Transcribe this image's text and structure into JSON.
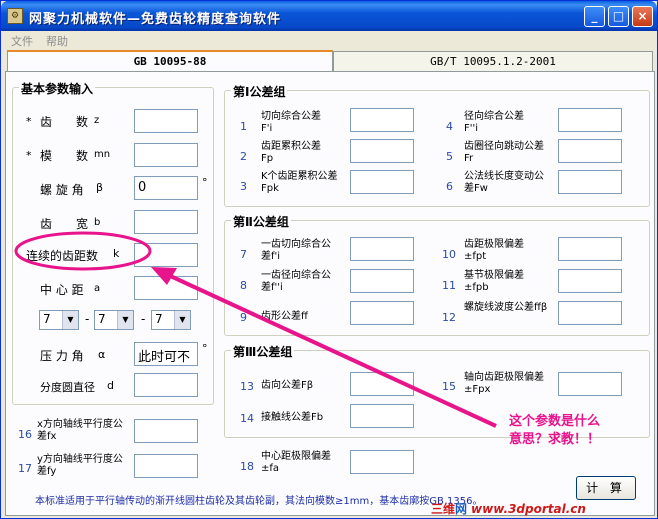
{
  "window": {
    "title": "网聚力机械软件—免费齿轮精度查询软件",
    "icon_name": "app-icon",
    "controls": {
      "minimize": "_",
      "maximize": "□",
      "close": "×"
    }
  },
  "menu": {
    "file": "文件",
    "help": "帮助"
  },
  "tabs": [
    {
      "label": "GB 10095-88",
      "active": true
    },
    {
      "label": "GB/T 10095.1.2-2001",
      "active": false
    }
  ],
  "basic": {
    "title": "基本参数输入",
    "fields": [
      {
        "star": "*",
        "label": "齿　　数",
        "sym": "z",
        "value": ""
      },
      {
        "star": "*",
        "label": "模　　数",
        "sym": "mn",
        "value": ""
      },
      {
        "star": "",
        "label": "螺 旋 角",
        "sym": "β",
        "value": "0",
        "unit": "°"
      },
      {
        "star": "",
        "label": "齿　　宽",
        "sym": "b",
        "value": ""
      },
      {
        "star": "",
        "label": "连续的齿距数",
        "sym": "k",
        "value": ""
      },
      {
        "star": "",
        "label": "中 心 距",
        "sym": "a",
        "value": ""
      }
    ],
    "grades": [
      "7",
      "7",
      "7"
    ],
    "grade_sep": "-",
    "pressure": {
      "label": "压 力 角",
      "sym": "α",
      "value": "此时可不",
      "unit": "°"
    },
    "pitch_dia": {
      "label": "分度圆直径",
      "sym": "d",
      "value": ""
    }
  },
  "group1": {
    "title": "第Ⅰ公差组",
    "items": [
      {
        "num": "1",
        "label": "切向综合公差",
        "sym": "F'i"
      },
      {
        "num": "2",
        "label": "齿距累积公差",
        "sym": "Fp"
      },
      {
        "num": "3",
        "label": "K个齿距累积公差",
        "sym": "Fpk"
      },
      {
        "num": "4",
        "label": "径向综合公差",
        "sym": "F''i"
      },
      {
        "num": "5",
        "label": "齿圈径向跳动公差",
        "sym": "Fr"
      },
      {
        "num": "6",
        "label": "公法线长度变动公差",
        "sym": "Fw"
      }
    ]
  },
  "group2": {
    "title": "第Ⅱ公差组",
    "items": [
      {
        "num": "7",
        "label": "一齿切向综合公差",
        "sym": "f'i"
      },
      {
        "num": "8",
        "label": "一齿径向综合公差",
        "sym": "f''i"
      },
      {
        "num": "9",
        "label": "齿形公差",
        "sym": "ff"
      },
      {
        "num": "10",
        "label": "齿距极限偏差±",
        "sym": "fpt"
      },
      {
        "num": "11",
        "label": "基节极限偏差±",
        "sym": "fpb"
      },
      {
        "num": "12",
        "label": "螺旋线波度公差",
        "sym": "ffβ"
      }
    ]
  },
  "group3": {
    "title": "第Ⅲ公差组",
    "items": [
      {
        "num": "13",
        "label": "齿向公差",
        "sym": "Fβ"
      },
      {
        "num": "14",
        "label": "接触线公差",
        "sym": "Fb"
      },
      {
        "num": "15",
        "label": "轴向齿距极限偏差±",
        "sym": "Fpx"
      }
    ]
  },
  "extra": [
    {
      "num": "16",
      "label": "x方向轴线平行度公差",
      "sym": "fx"
    },
    {
      "num": "17",
      "label": "y方向轴线平行度公差",
      "sym": "fy"
    },
    {
      "num": "18",
      "label": "中心距极限偏差±",
      "sym": "fa"
    }
  ],
  "footnote": "本标准适用于平行轴传动的渐开线圆柱齿轮及其齿轮副，其法向模数≥1mm，基本齿廓按GB 1356。",
  "calc_button": "计 算",
  "annotation": {
    "line1": "这个参数是什么",
    "line2": "意思？求教！！",
    "color": "#e8148c"
  },
  "watermark": {
    "a": "三维",
    "b": "网",
    "c": "www.3dportal.cn"
  }
}
